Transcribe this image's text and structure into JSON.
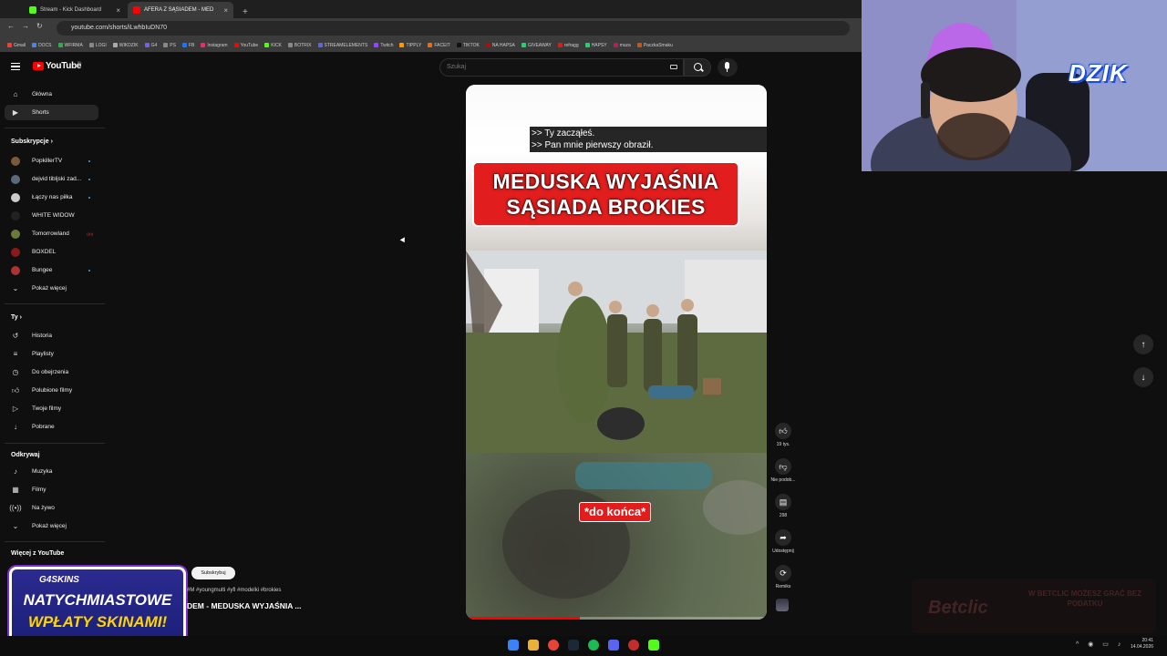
{
  "browser": {
    "tabs": [
      {
        "label": "Stream - Kick Dashboard",
        "icon": "kick-icon",
        "color": "#53fc18"
      },
      {
        "label": "AFERA Z SĄSIADEM - MED",
        "icon": "youtube-icon",
        "color": "#ff0000"
      }
    ],
    "new_tab": "+",
    "close_glyph": "×",
    "url": "youtube.com/shorts/iLwhbIuDN70",
    "bookmarks": [
      "Gmail",
      "DOCS",
      "WFIRMA",
      "LOGI",
      "WIKDZIK",
      "G4",
      "PS",
      "FB",
      "Instagram",
      "YouTube",
      "KICK",
      "BOTRIX",
      "STREAMELEMENTS",
      "Twitch",
      "TIPPLY",
      "FACEIT",
      "TIKTOK",
      "NA HAPSA",
      "GIVEAWAY",
      "refragg",
      "HAPSY",
      "muza",
      "PaczkaSmaku"
    ]
  },
  "youtube": {
    "logo_text": "YouTube",
    "country": "PL",
    "search_placeholder": "Szukaj"
  },
  "sidebar": {
    "main": [
      {
        "label": "Główna",
        "icon": "home-icon"
      },
      {
        "label": "Shorts",
        "icon": "shorts-icon",
        "active": true
      }
    ],
    "subs_heading": "Subskrypcje",
    "subs": [
      {
        "label": "PopkillerTV",
        "color": "#7a5a3a",
        "badge": "dot"
      },
      {
        "label": "dejvid tibljski zad...",
        "color": "#5a6a7a",
        "badge": "dot"
      },
      {
        "label": "Łączy nas piłka",
        "color": "#ccc",
        "badge": "dot"
      },
      {
        "label": "WHITE WIDOW",
        "color": "#222",
        "badge": ""
      },
      {
        "label": "Tomorrowland",
        "color": "#6a7a3a",
        "badge": "live"
      },
      {
        "label": "BOXDEL",
        "color": "#8a1a1a",
        "badge": ""
      },
      {
        "label": "Bungee",
        "color": "#a33",
        "badge": "dot"
      }
    ],
    "subs_more": "Pokaż więcej",
    "you_heading": "Ty",
    "you": [
      {
        "label": "Historia",
        "icon": "history-icon"
      },
      {
        "label": "Playlisty",
        "icon": "playlist-icon"
      },
      {
        "label": "Do obejrzenia",
        "icon": "watch-later-icon"
      },
      {
        "label": "Polubione filmy",
        "icon": "like-icon"
      },
      {
        "label": "Twoje filmy",
        "icon": "your-videos-icon"
      },
      {
        "label": "Pobrane",
        "icon": "download-icon"
      }
    ],
    "explore_heading": "Odkrywaj",
    "explore": [
      {
        "label": "Muzyka",
        "icon": "music-icon"
      },
      {
        "label": "Filmy",
        "icon": "movies-icon"
      },
      {
        "label": "Na żywo",
        "icon": "live-icon"
      }
    ],
    "explore_more": "Pokaż więcej",
    "more_heading": "Więcej z YouTube"
  },
  "short": {
    "subtitle_line1": ">> Ty zacząłeś.",
    "subtitle_line2": ">> Pan mnie pierwszy obraził.",
    "title_line1": "MEDUSKA WYJAŚNIA",
    "title_line2": "SĄSIADA BROKIES",
    "overlay_caption": "*do końca*",
    "progress": 0.38,
    "hashtags": "#M #youngmulti #yfl #modelki #brokies",
    "video_title": "DEM - MEDUSKA WYJAŚNIA ...",
    "subscribe": "Subskrybuj"
  },
  "actions": [
    {
      "label": "19 tys.",
      "icon": "thumbs-up-icon"
    },
    {
      "label": "Nie podob...",
      "icon": "thumbs-down-icon"
    },
    {
      "label": "298",
      "icon": "comment-icon"
    },
    {
      "label": "Udostępnij",
      "icon": "share-icon"
    },
    {
      "label": "Remiks",
      "icon": "remix-icon"
    }
  ],
  "overlay": {
    "webcam_logo": "DZIK",
    "promo_brand": "G4SKINS",
    "promo_line1": "NATYCHMIASTOWE",
    "promo_line2": "WPŁATY SKINAMI!",
    "betclic_name": "Betclic",
    "betclic_tag": "W BETCLIC MOŻESZ GRAĆ BEZ PODATKU"
  },
  "taskbar": {
    "time": "20:41",
    "date": "14.04.2026"
  }
}
